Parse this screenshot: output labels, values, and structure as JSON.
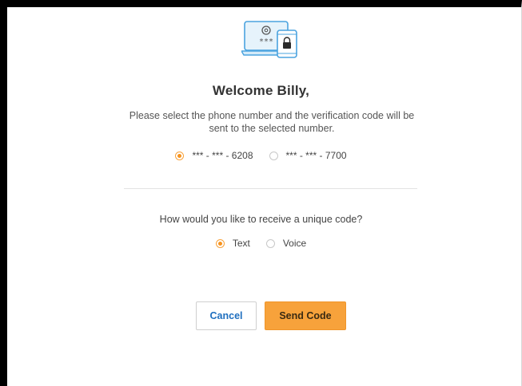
{
  "header": {
    "icon": "laptop-phone-lock-icon",
    "title": "Welcome  Billy,",
    "subtitle": "Please select the phone number and the verification code will be sent to the selected number."
  },
  "phone_options": [
    {
      "label": "*** - *** - 6208",
      "checked": true
    },
    {
      "label": "*** - *** - 7700",
      "checked": false
    }
  ],
  "method": {
    "question": "How would you like to receive a unique code?",
    "options": [
      {
        "label": "Text",
        "checked": true
      },
      {
        "label": "Voice",
        "checked": false
      }
    ]
  },
  "buttons": {
    "cancel_label": "Cancel",
    "send_label": "Send Code"
  },
  "colors": {
    "accent": "#f7a23b",
    "link": "#1f6fbf",
    "icon_blue": "#4aa3df"
  }
}
